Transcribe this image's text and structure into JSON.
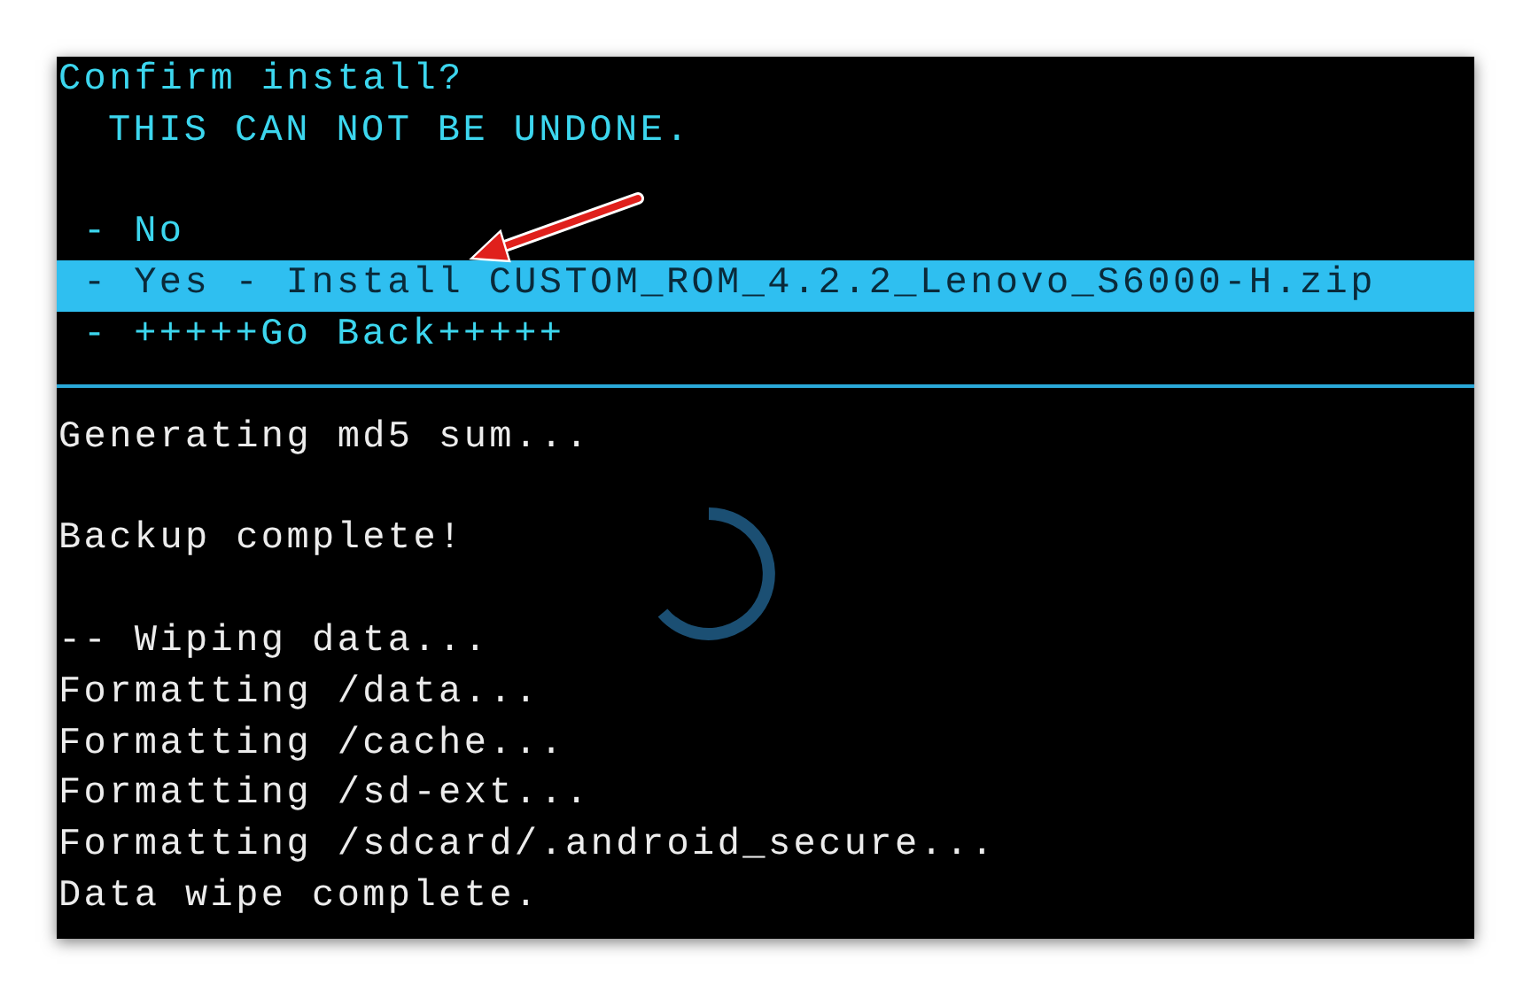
{
  "prompt": {
    "title": "Confirm install?",
    "warning": "THIS CAN NOT BE UNDONE."
  },
  "menu": [
    {
      "label": "- No",
      "selected": false
    },
    {
      "label": "- Yes - Install CUSTOM_ROM_4.2.2_Lenovo_S6000-H.zip",
      "selected": true
    },
    {
      "label": "- +++++Go Back+++++",
      "selected": false
    }
  ],
  "log": [
    {
      "lines": [
        "Generating md5 sum..."
      ]
    },
    {
      "lines": [
        "Backup complete!"
      ]
    },
    {
      "lines": [
        "-- Wiping data...",
        "Formatting /data...",
        "Formatting /cache...",
        "Formatting /sd-ext...",
        "Formatting /sdcard/.android_secure...",
        "Data wipe complete."
      ]
    }
  ]
}
